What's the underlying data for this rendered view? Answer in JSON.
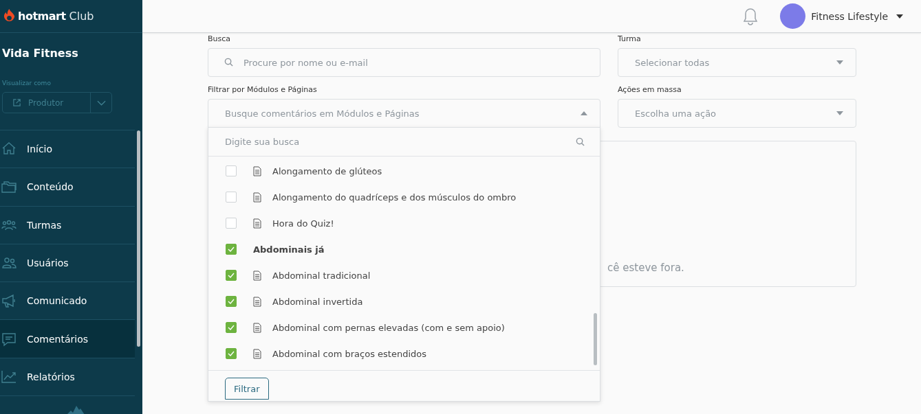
{
  "sidebar": {
    "brand": "hotmart",
    "brand_suffix": "Club",
    "course_title": "Vida Fitness",
    "view_as": {
      "label": "Visualizar como",
      "value": "Produtor"
    },
    "items": [
      {
        "label": "Início",
        "selected": false
      },
      {
        "label": "Conteúdo",
        "selected": false
      },
      {
        "label": "Turmas",
        "selected": false
      },
      {
        "label": "Usuários",
        "selected": false
      },
      {
        "label": "Comunicado",
        "selected": false
      },
      {
        "label": "Comentários",
        "selected": true
      },
      {
        "label": "Relatórios",
        "selected": false
      }
    ]
  },
  "header": {
    "user_name": "Fitness Lifestyle"
  },
  "filters": {
    "search": {
      "label": "Busca",
      "placeholder": "Procure por nome ou e-mail"
    },
    "class": {
      "label": "Turma",
      "placeholder": "Selecionar todas"
    },
    "modules": {
      "label": "Filtrar por Módulos e Páginas",
      "placeholder": "Busque comentários em Módulos e Páginas",
      "expanded": true
    },
    "bulk_actions": {
      "label": "Ações em massa",
      "placeholder": "Escolha uma ação"
    }
  },
  "module_dropdown": {
    "search_placeholder": "Digite sua busca",
    "items": [
      {
        "label": "Alongamento de glúteos",
        "kind": "page",
        "checked": false
      },
      {
        "label": "Alongamento do quadríceps e dos músculos do ombro",
        "kind": "page",
        "checked": false
      },
      {
        "label": "Hora do Quiz!",
        "kind": "page",
        "checked": false
      },
      {
        "label": "Abdominais já",
        "kind": "module",
        "checked": true
      },
      {
        "label": "Abdominal tradicional",
        "kind": "page",
        "checked": true
      },
      {
        "label": "Abdominal invertida",
        "kind": "page",
        "checked": true
      },
      {
        "label": "Abdominal com pernas elevadas (com e sem apoio)",
        "kind": "page",
        "checked": true
      },
      {
        "label": "Abdominal com braços estendidos",
        "kind": "page",
        "checked": true
      }
    ],
    "button": "Filtrar"
  },
  "notice": {
    "text": "cê esteve fora."
  }
}
